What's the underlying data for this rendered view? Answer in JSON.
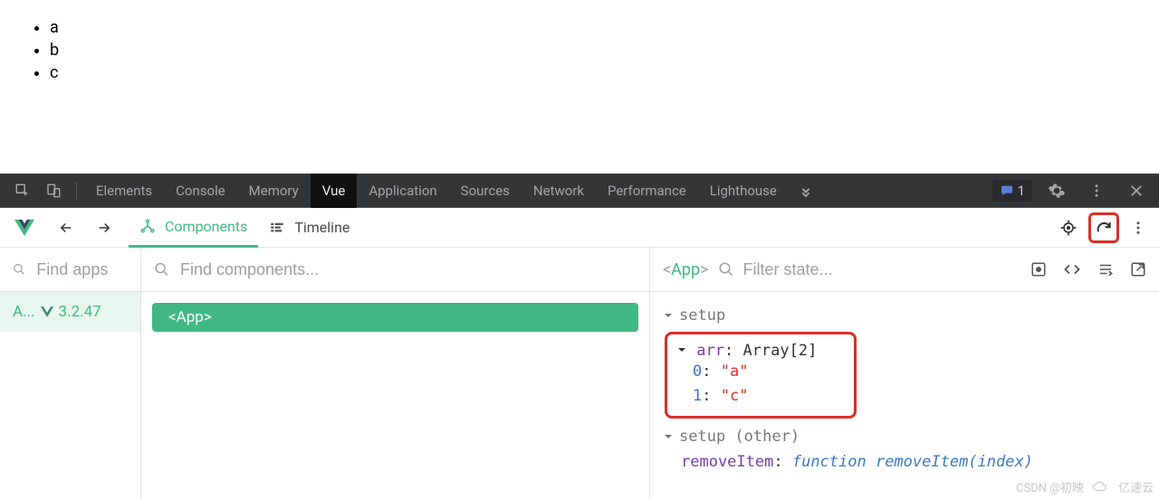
{
  "page": {
    "items": [
      "a",
      "b",
      "c"
    ]
  },
  "devtools": {
    "tabs": [
      "Elements",
      "Console",
      "Memory",
      "Vue",
      "Application",
      "Sources",
      "Network",
      "Performance",
      "Lighthouse"
    ],
    "active": "Vue",
    "chat_count": "1"
  },
  "vuebar": {
    "tab_components": "Components",
    "tab_timeline": "Timeline"
  },
  "left": {
    "search_placeholder": "Find apps",
    "app_label": "A...",
    "vue_version": "3.2.47"
  },
  "mid": {
    "search_placeholder": "Find components...",
    "component_chip": "<App>"
  },
  "right": {
    "title_prefix": "<",
    "title_name": "App",
    "title_suffix": ">",
    "filter_placeholder": "Filter state...",
    "section_setup": "setup",
    "arr_label": "arr",
    "arr_type": "Array[2]",
    "arr_items": [
      {
        "idx": "0",
        "val": "\"a\""
      },
      {
        "idx": "1",
        "val": "\"c\""
      }
    ],
    "section_setup_other": "setup (other)",
    "fn_name": "removeItem",
    "fn_sig": "function removeItem(index)"
  },
  "watermark": {
    "csdn": "CSDN @初映",
    "brand": "亿速云"
  }
}
